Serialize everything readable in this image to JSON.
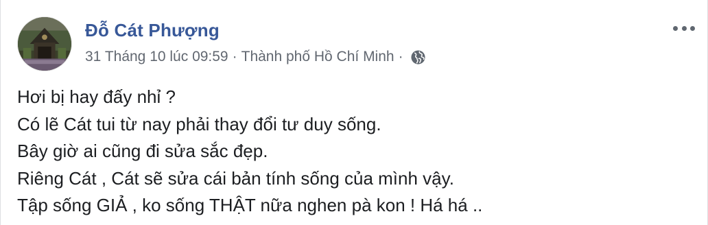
{
  "post": {
    "author_name": "Đỗ Cát Phượng",
    "timestamp": "31 Tháng 10 lúc 09:59",
    "separator": "·",
    "location": "Thành phố Hồ Chí Minh",
    "privacy_icon": "globe-icon",
    "more_icon": "more-options-icon",
    "lines": [
      "Hơi bị hay đấy nhỉ ?",
      "Có lẽ Cát tui từ nay phải thay đổi tư duy sống.",
      "Bây giờ ai cũng đi sửa sắc đẹp.",
      "Riêng Cát , Cát sẽ sửa cái bản tính sống của mình vậy.",
      "Tập sống GIẢ , ko sống THẬT nữa nghen pà kon ! Há há .."
    ]
  },
  "colors": {
    "author": "#385898",
    "meta": "#616770",
    "text": "#1c1e21",
    "icon": "#606770"
  }
}
